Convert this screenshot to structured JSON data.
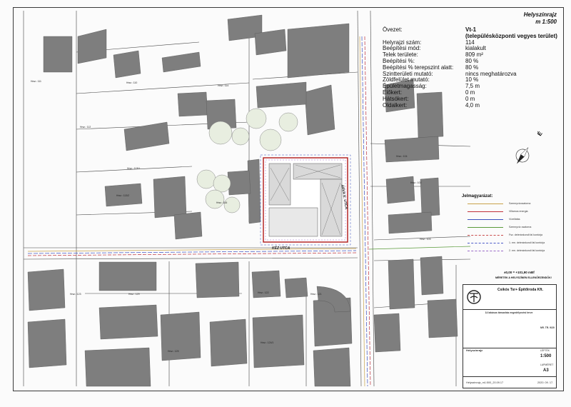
{
  "title": {
    "line1": "Helyszínrajz",
    "line2": "m 1:500"
  },
  "zoning": {
    "rows": [
      {
        "label": "Övezet:",
        "value": "Vt-1"
      },
      {
        "label": "",
        "value": "(településközponti vegyes terület)"
      },
      {
        "label": "Helyrajzi szám:",
        "value": "114"
      },
      {
        "label": "Beépítési mód:",
        "value": "kialakult"
      },
      {
        "label": "Telek területe:",
        "value": "809 m²"
      },
      {
        "label": "Beépítési %:",
        "value": "80 %"
      },
      {
        "label": "Beépítési % terepszint alatt:",
        "value": "80 %"
      },
      {
        "label": "Szintterületi mutató:",
        "value": "nincs meghatározva"
      },
      {
        "label": "Zöldfelület mutató:",
        "value": "10 %"
      },
      {
        "label": "Épületmagasság:",
        "value": "7,5 m"
      },
      {
        "label": "Előkert:",
        "value": "0 m"
      },
      {
        "label": "Hátsókert:",
        "value": "0 m"
      },
      {
        "label": "Oldalkert:",
        "value": "4,0 m"
      }
    ]
  },
  "legend": {
    "heading": "Jelmagyarázat:",
    "items": [
      {
        "label": "Szennyvízcsatorna",
        "color": "#c8a24a"
      },
      {
        "label": "Villamos energia",
        "color": "#c0303a"
      },
      {
        "label": "Vízellátás",
        "color": "#3a4fc0"
      },
      {
        "label": "Szennyvíz csatorna",
        "color": "#5a9a3a"
      },
      {
        "label": "Fsz. deleránkondi fal kontúrja",
        "color": "#c84a4a"
      },
      {
        "label": "1. em. deleránkondi fal kontúrja",
        "color": "#4a5ac8"
      },
      {
        "label": "2. em. deleránkondi fal kontúrja",
        "color": "#9a6ac8"
      }
    ],
    "elevation": "±0,00 = +101,90 mBf",
    "note": "MÉRETEK A HELYSZÍNEN ELLENŐRZENDŐK!"
  },
  "streets": {
    "vertical": "ÁRVA E. UTCA",
    "horizontal": "KÉZ UTCA"
  },
  "parcels": [
    "Hrsz.: 111",
    "Hrsz.: 110",
    "Hrsz.: 112",
    "Hrsz.: 113/1",
    "Hrsz.: 113/2",
    "Hrsz.: 114",
    "Hrsz.: 104",
    "Hrsz.: 102",
    "Hrsz.: 103",
    "Hrsz.: 116",
    "Hrsz.: 122",
    "Hrsz.: 121",
    "Hrsz.: 125",
    "Hrsz.: 124/1",
    "Hrsz.: 123",
    "Hrsz.: 129"
  ],
  "title_block": {
    "company": "Csikós Tsr+ Építőiroda Kft.",
    "project": "14 lakásos társasház engedélyezési terve",
    "drawing_name": "Helyszínrajz",
    "scale_label": "LÉPTÉK",
    "scale": "1:500",
    "sheet_label": "LAPMÉRET",
    "sheet": "A3",
    "file_name": "Helyszinrajz_m1:500_20.09.17",
    "date": "2020. 09. 17.",
    "number": "NR. TR. 9/20"
  },
  "colors": {
    "building": "#7e7e7e",
    "subject_outline": "#b01818",
    "utility_red": "#c0303a",
    "utility_blue": "#3a4fc0",
    "utility_green": "#5a9a3a",
    "tree": "#e8eee0",
    "road": "#f3f3f3"
  }
}
